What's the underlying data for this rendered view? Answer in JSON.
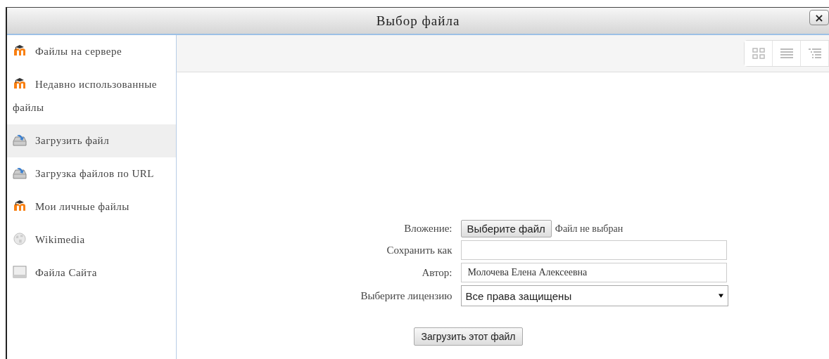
{
  "window": {
    "title": "Выбор файла",
    "close": "×"
  },
  "sidebar": {
    "items": [
      {
        "label": "Файлы на сервере",
        "kind": "moodle",
        "selected": false
      },
      {
        "label": "Недавно использованные файлы",
        "kind": "moodle",
        "selected": false
      },
      {
        "label": "Загрузить файл",
        "kind": "upload",
        "selected": true
      },
      {
        "label": "Загрузка файлов по URL",
        "kind": "upload",
        "selected": false
      },
      {
        "label": "Мои личные файлы",
        "kind": "moodle",
        "selected": false
      },
      {
        "label": "Wikimedia",
        "kind": "wiki",
        "selected": false
      },
      {
        "label": "Файла Сайта",
        "kind": "site",
        "selected": false
      }
    ]
  },
  "view_buttons": [
    {
      "kind": "icons",
      "selected": false
    },
    {
      "kind": "list",
      "selected": false
    },
    {
      "kind": "tree",
      "selected": false
    }
  ],
  "form": {
    "attachment_label": "Вложение:",
    "choose_button": "Выберите файл",
    "no_file": "Файл не выбран",
    "save_as_label": "Сохранить как",
    "author_label": "Автор:",
    "author_value": "Молочева Елена Алексеевна",
    "license_label": "Выберите лицензию",
    "license_value": "Все права защищены",
    "submit": "Загрузить этот файл"
  }
}
